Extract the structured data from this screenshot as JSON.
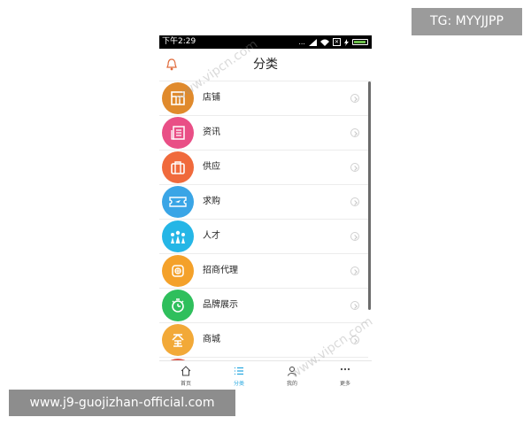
{
  "status": {
    "time": "下午2:29",
    "dots": "...",
    "x_box": "✕"
  },
  "header": {
    "title": "分类",
    "bell_icon": "bell-icon"
  },
  "categories": [
    {
      "label": "店铺",
      "color": "#e08a2c",
      "icon": "shop-icon"
    },
    {
      "label": "资讯",
      "color": "#e94f86",
      "icon": "news-icon"
    },
    {
      "label": "供应",
      "color": "#f06a3c",
      "icon": "briefcase-icon"
    },
    {
      "label": "求购",
      "color": "#3aa5e6",
      "icon": "ticket-icon"
    },
    {
      "label": "人才",
      "color": "#25b6e6",
      "icon": "people-icon"
    },
    {
      "label": "招商代理",
      "color": "#f4a12a",
      "icon": "agency-icon"
    },
    {
      "label": "品牌展示",
      "color": "#2fbf5c",
      "icon": "stopwatch-icon"
    },
    {
      "label": "商城",
      "color": "#f2a938",
      "icon": "mall-icon"
    }
  ],
  "tabbar": [
    {
      "label": "首页",
      "icon": "home-icon",
      "active": false
    },
    {
      "label": "分类",
      "icon": "list-icon",
      "active": true
    },
    {
      "label": "我的",
      "icon": "user-icon",
      "active": false
    },
    {
      "label": "更多",
      "icon": "more-icon",
      "active": false
    }
  ],
  "overlay": {
    "tg": "TG: MYYJJPP",
    "url": "www.j9-guojizhan-official.com",
    "watermark": "www.vipcn.com"
  },
  "colors": {
    "accent": "#29a9e0",
    "status_bg": "#000000"
  }
}
